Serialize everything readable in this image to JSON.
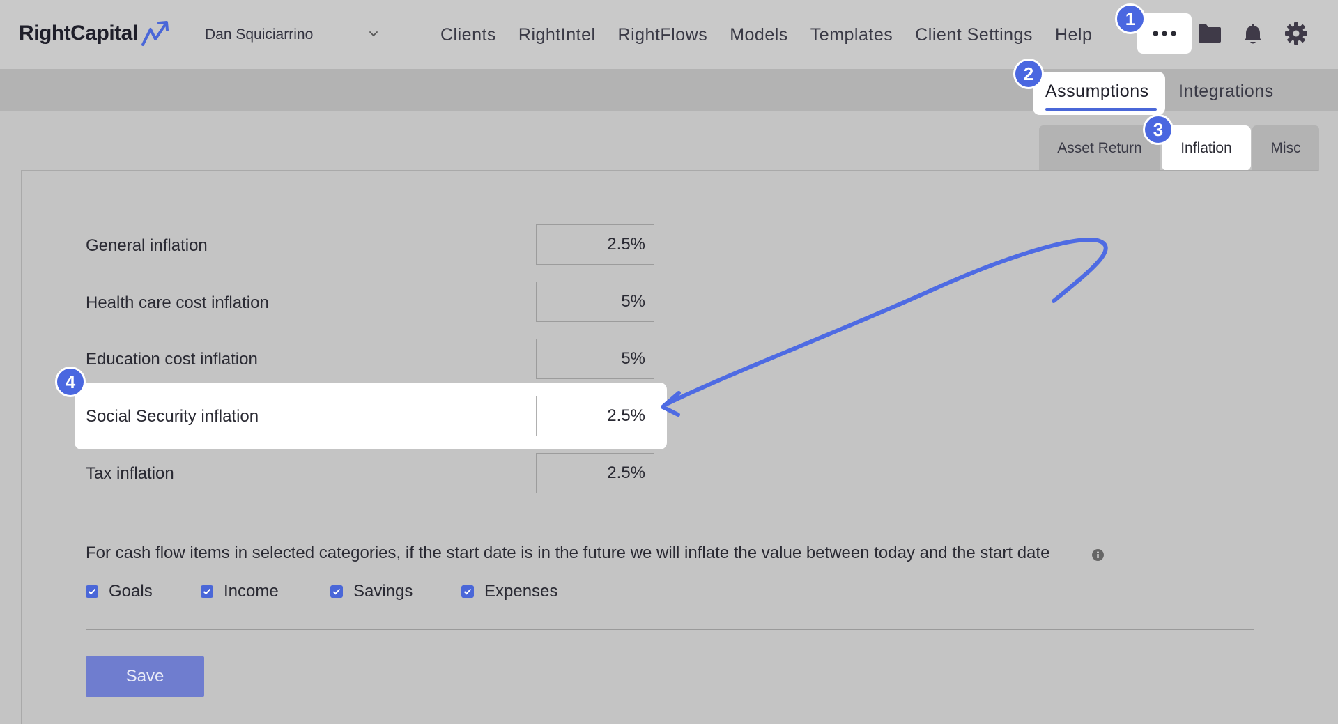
{
  "header": {
    "logo_text": "RightCapital",
    "account_name": "Dan Squiciarrino",
    "nav": [
      "Clients",
      "RightIntel",
      "RightFlows",
      "Models",
      "Templates",
      "Client Settings",
      "Help"
    ],
    "icons": [
      "more-icon",
      "folder-icon",
      "bell-icon",
      "gear-icon"
    ]
  },
  "settings_tabs": {
    "active": "Assumptions",
    "other": "Integrations"
  },
  "assumption_tabs": [
    "Asset Return",
    "Inflation",
    "Misc"
  ],
  "inflation": {
    "rows": [
      {
        "label": "General inflation",
        "value": "2.5%"
      },
      {
        "label": "Health care cost inflation",
        "value": "5%"
      },
      {
        "label": "Education cost inflation",
        "value": "5%"
      },
      {
        "label": "Social Security inflation",
        "value": "2.5%"
      },
      {
        "label": "Tax inflation",
        "value": "2.5%"
      }
    ],
    "note": "For cash flow items in selected categories, if the start date is in the future we will inflate the value between today and the start date",
    "categories": [
      {
        "label": "Goals",
        "checked": true
      },
      {
        "label": "Income",
        "checked": true
      },
      {
        "label": "Savings",
        "checked": true
      },
      {
        "label": "Expenses",
        "checked": true
      }
    ],
    "save_label": "Save"
  },
  "steps": [
    "1",
    "2",
    "3",
    "4"
  ],
  "colors": {
    "accent": "#4a67e0",
    "save_button": "#6f7dcf",
    "background": "#c4c4c4"
  }
}
